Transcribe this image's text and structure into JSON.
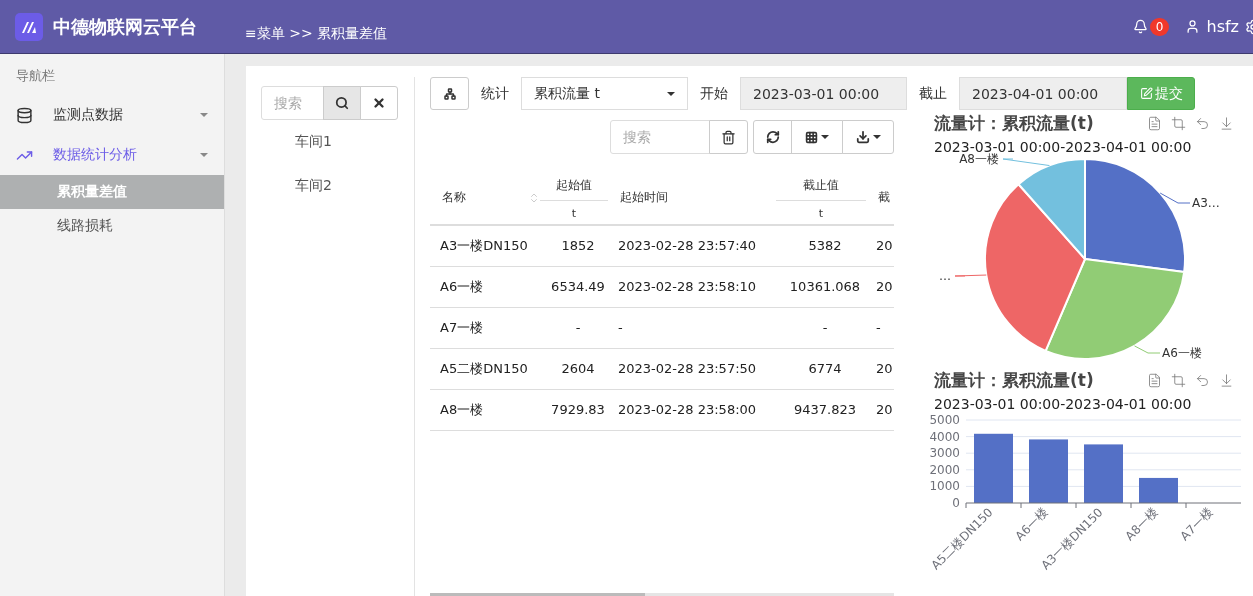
{
  "header": {
    "title": "中德物联网云平台",
    "breadcrumb": "≡菜单 >> 累积量差值",
    "notifications": "0",
    "user": "hsfz"
  },
  "sidebar": {
    "title": "导航栏",
    "items": [
      {
        "label": "监测点数据",
        "expanded": false
      },
      {
        "label": "数据统计分析",
        "expanded": true,
        "children": [
          {
            "label": "累积量差值",
            "selected": true
          },
          {
            "label": "线路损耗",
            "selected": false
          }
        ]
      }
    ]
  },
  "tree": {
    "search": {
      "placeholder": "搜索"
    },
    "items": [
      "车间1",
      "车间2"
    ]
  },
  "filters": {
    "stat_label": "统计",
    "stat_value": "累积流量 t",
    "start_label": "开始",
    "start_value": "2023-03-01 00:00",
    "end_label": "截止",
    "end_value": "2023-04-01 00:00",
    "submit": "提交"
  },
  "table": {
    "search": {
      "placeholder": "搜索"
    },
    "columns": [
      {
        "label": "名称",
        "sortable": true
      },
      {
        "label": "起始值",
        "unit": "t"
      },
      {
        "label": "起始时间"
      },
      {
        "label": "截止值",
        "unit": "t"
      },
      {
        "label": "截"
      }
    ],
    "rows": [
      [
        "A3一楼DN150",
        "1852",
        "2023-02-28 23:57:40",
        "5382",
        "20"
      ],
      [
        "A6一楼",
        "6534.49",
        "2023-02-28 23:58:10",
        "10361.068",
        "20"
      ],
      [
        "A7一楼",
        "-",
        "-",
        "-",
        "-"
      ],
      [
        "A5二楼DN150",
        "2604",
        "2023-02-28 23:57:50",
        "6774",
        "20"
      ],
      [
        "A8一楼",
        "7929.83",
        "2023-02-28 23:58:00",
        "9437.823",
        "20"
      ]
    ]
  },
  "charts": [
    {
      "title": "流量计：累积流量(t)",
      "subtitle": "2023-03-01 00:00-2023-04-01 00:00",
      "chart_data": {
        "type": "pie",
        "categories": [
          "A3…",
          "A6一楼",
          "…",
          "A8一楼"
        ],
        "series": [
          {
            "colors": [
              "#5470c6",
              "#91cc75",
              "#ee6666",
              "#73c0de"
            ],
            "values": [
              27.08,
              29.36,
              31.99,
              11.57
            ]
          }
        ]
      }
    },
    {
      "title": "流量计：累积流量(t)",
      "subtitle": "2023-03-01 00:00-2023-04-01 00:00",
      "chart_data": {
        "type": "bar",
        "categories": [
          "A5二楼DN150",
          "A6一楼",
          "A3一楼DN150",
          "A8一楼",
          "A7一楼"
        ],
        "series": [
          {
            "color": "#5470c6",
            "values": [
              4170,
              3830,
              3530,
              1510,
              0
            ]
          }
        ],
        "grid": true,
        "ylim": [
          0,
          5000
        ],
        "yticks": [
          0,
          1000,
          2000,
          3000,
          4000,
          5000
        ]
      }
    }
  ]
}
